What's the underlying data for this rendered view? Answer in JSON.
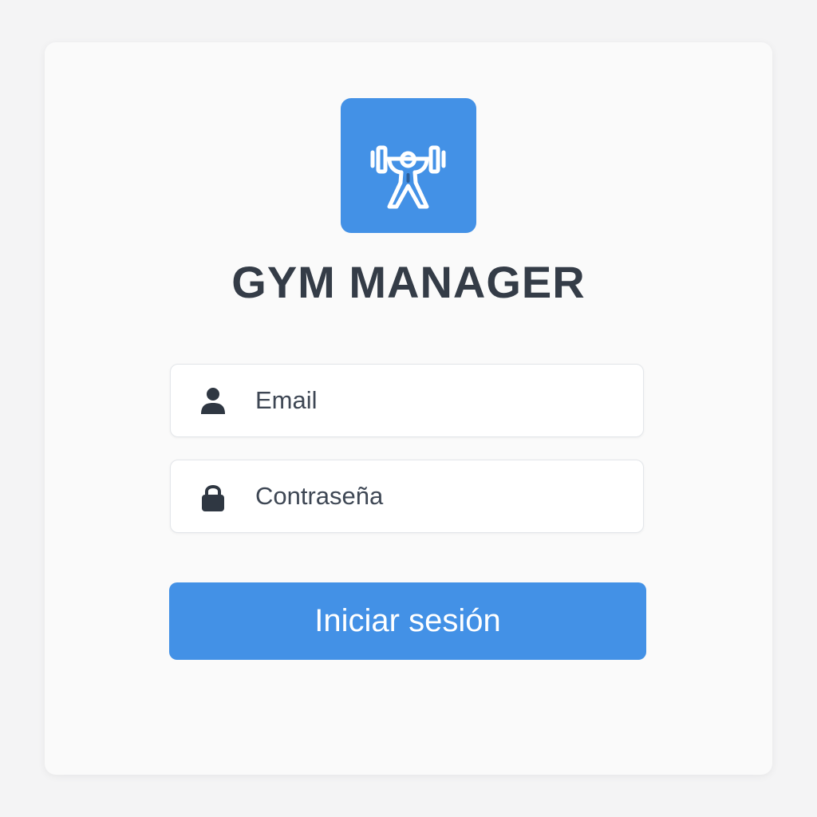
{
  "app": {
    "title": "GYM MANAGER",
    "logo_icon": "weightlifter-icon",
    "accent_color": "#4391e6"
  },
  "login_form": {
    "email": {
      "icon": "user-icon",
      "placeholder": "Email",
      "value": ""
    },
    "password": {
      "icon": "lock-icon",
      "placeholder": "Contraseña",
      "value": ""
    },
    "submit_label": "Iniciar sesión"
  }
}
